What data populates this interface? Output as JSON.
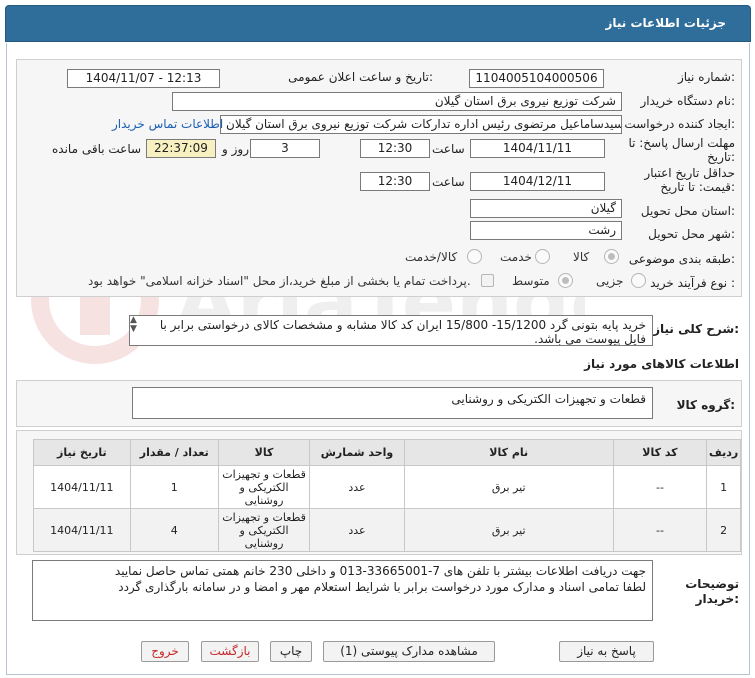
{
  "header": {
    "title": "جزئیات اطلاعات نیاز"
  },
  "form": {
    "need_number_label": "شماره نیاز:",
    "need_number": "1104005104000506",
    "announce_label": "تاریخ و ساعت اعلان عمومی:",
    "announce_value": "1404/11/07 - 12:13",
    "buyer_org_label": "نام دستگاه خریدار:",
    "buyer_org": "شرکت توزیع نیروی برق استان گیلان",
    "creator_label": "ایجاد کننده درخواست:",
    "creator": "سیدساماعیل مرتضوی رئیس اداره تدارکات شرکت توزیع نیروی برق استان گیلان",
    "contact_link": "اطلاعات تماس خریدار",
    "deadline_label_1": "مهلت ارسال پاسخ: تا",
    "deadline_label_2": "تاریخ:",
    "deadline_date": "1404/11/11",
    "time_label": "ساعت",
    "deadline_time": "12:30",
    "days_value": "3",
    "days_label": "روز و",
    "remaining_time": "22:37:09",
    "remaining_label": "ساعت باقی مانده",
    "validity_label_1": "حداقل تاریخ اعتبار",
    "validity_label_2": "قیمت: تا تاریخ:",
    "validity_date": "1404/12/11",
    "validity_time": "12:30",
    "province_label": "استان محل تحویل:",
    "province": "گیلان",
    "city_label": "شهر محل تحویل:",
    "city": "رشت",
    "category_label": "طبقه بندی موضوعی:",
    "category_options": [
      "کالا",
      "خدمت",
      "کالا/خدمت"
    ],
    "process_label": "نوع فرآیند خرید :",
    "process_options": [
      "جزیی",
      "متوسط"
    ],
    "payment_note": "پرداخت تمام یا بخشی از مبلغ خرید،از محل \"اسناد خزانه اسلامی\" خواهد بود."
  },
  "description": {
    "label": "شرح کلی نیاز:",
    "text": "خرید پایه بتونی گرد 15/1200- 15/800 ایران کد کالا مشابه و مشخصات کالای درخواستی برابر با فایل پیوست می باشد."
  },
  "goods_info": {
    "title": "اطلاعات کالاهای مورد نیاز",
    "group_label": "گروه کالا:",
    "group_value": "قطعات و تجهیزات الکتریکی و روشنایی"
  },
  "table": {
    "headers": [
      "ردیف",
      "کد کالا",
      "نام کالا",
      "واحد شمارش",
      "کالا",
      "تعداد / مقدار",
      "تاریخ نیاز"
    ],
    "rows": [
      [
        "1",
        "--",
        "تیر برق",
        "عدد",
        "قطعات و تجهیزات الکتریکی و روشنایی",
        "1",
        "1404/11/11"
      ],
      [
        "2",
        "--",
        "تیر برق",
        "عدد",
        "قطعات و تجهیزات الکتریکی و روشنایی",
        "4",
        "1404/11/11"
      ]
    ]
  },
  "buyer_notes": {
    "label_1": "توضیحات",
    "label_2": "خریدار:",
    "line_1": "جهت دریافت اطلاعات بیشتر با تلفن های 7-33665001-013 و داخلی 230 خانم همتی تماس حاصل نمایید",
    "line_2": "لطفا تمامی اسناد و مدارک مورد درخواست برابر با شرایط استعلام مهر و امضا و در سامانه بارگذاری گردد"
  },
  "buttons": {
    "reply": "پاسخ به نیاز",
    "attachments": "مشاهده مدارک پیوستی (1)",
    "print": "چاپ",
    "back": "بازگشت",
    "exit": "خروج"
  },
  "colors": {
    "header": "#2f6d9a",
    "link": "#1a5fb4",
    "highlight": "#f7f0c0",
    "danger": "#c62828"
  }
}
